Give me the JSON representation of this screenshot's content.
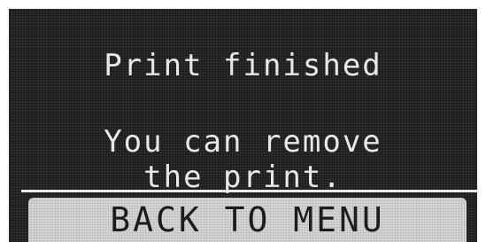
{
  "status": {
    "title": "Print finished",
    "message_line_1": "You can remove",
    "message_line_2": "the print."
  },
  "actions": {
    "back_to_menu_label": "BACK TO MENU"
  },
  "colors": {
    "screen_background": "#1c1c1c",
    "text": "#e8e8e8",
    "button_background": "#d6d6d6",
    "button_text": "#1c1c1c"
  }
}
